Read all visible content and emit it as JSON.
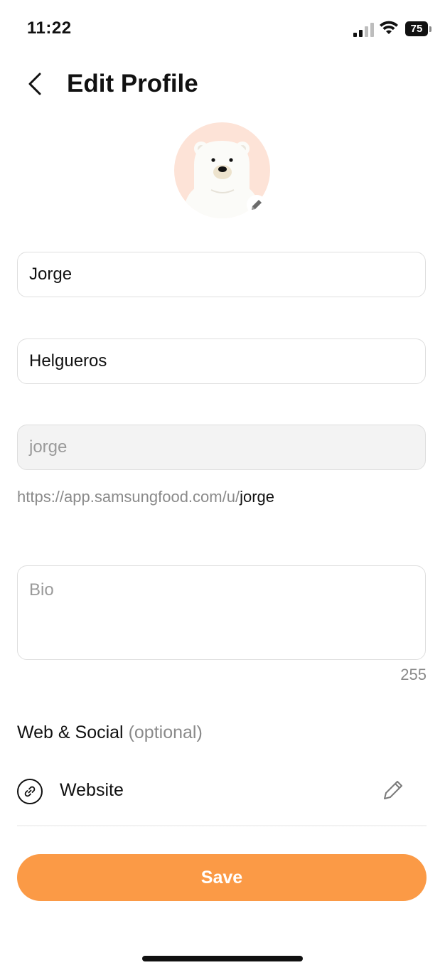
{
  "status_bar": {
    "time": "11:22",
    "battery": "75"
  },
  "header": {
    "title": "Edit Profile"
  },
  "form": {
    "first_name": "Jorge",
    "last_name": "Helgueros",
    "username": "jorge",
    "url_prefix": "https://app.samsungfood.com/u/",
    "url_username": "jorge",
    "bio_placeholder": "Bio",
    "bio_counter": "255"
  },
  "web_social": {
    "heading": "Web & Social",
    "optional": "(optional)",
    "website_label": "Website"
  },
  "actions": {
    "save_label": "Save"
  },
  "colors": {
    "accent": "#fb9a46",
    "avatar_bg": "#fde3d7"
  }
}
